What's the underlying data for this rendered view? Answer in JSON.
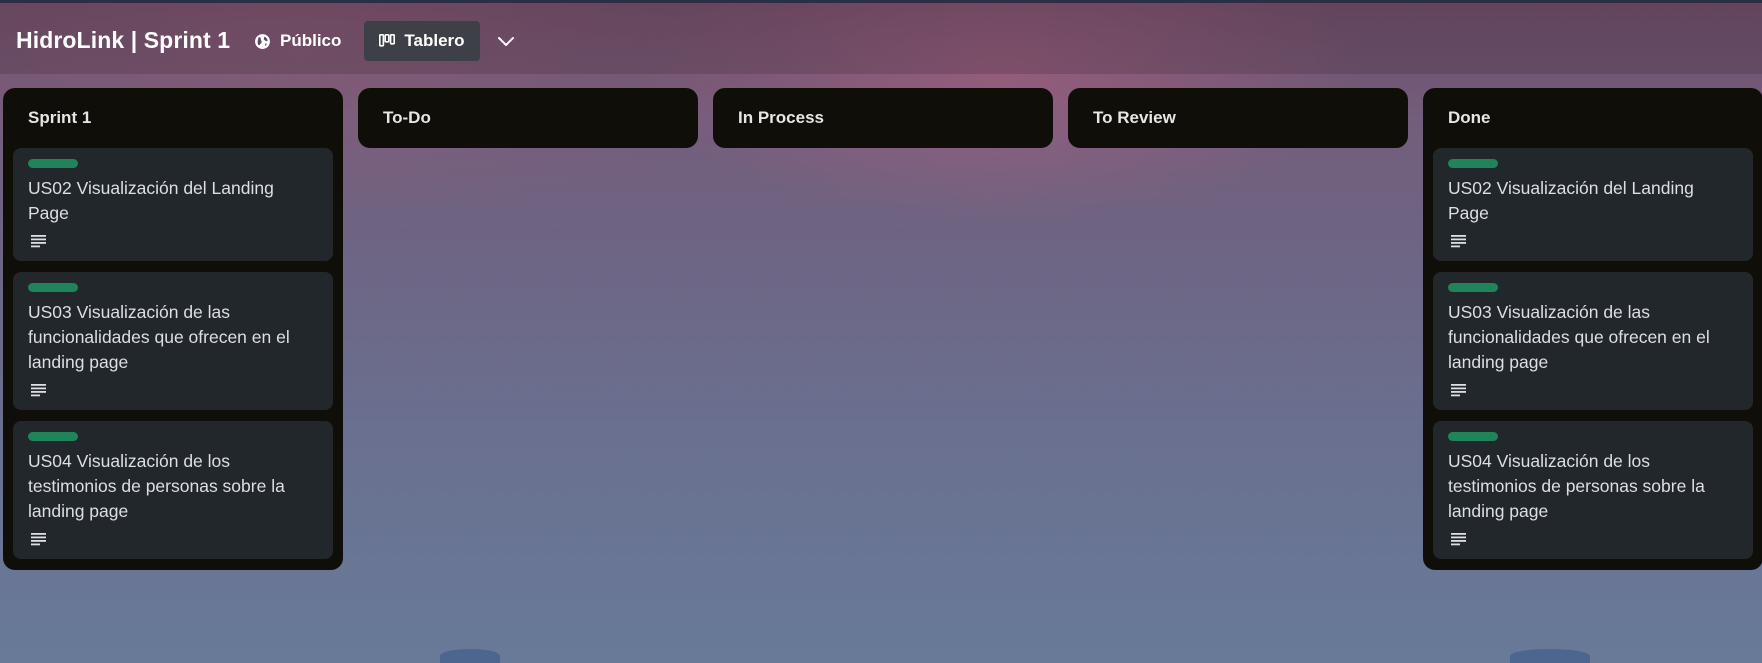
{
  "header": {
    "title": "HidroLink | Sprint 1",
    "visibility_label": "Público",
    "view_label": "Tablero",
    "icons": {
      "visibility": "globe-icon",
      "view": "board-icon",
      "views_dropdown": "chevron-down-icon"
    }
  },
  "colors": {
    "label_green": "#1f845a",
    "list_bg": "#0f0e08",
    "card_bg": "#22272b"
  },
  "lists": [
    {
      "title": "Sprint 1",
      "cards": [
        {
          "title": "US02 Visualización del Landing Page"
        },
        {
          "title": "US03 Visualización de las funcionalidades que ofrecen en el landing page"
        },
        {
          "title": "US04 Visualización de los testimonios de personas sobre la landing page"
        }
      ]
    },
    {
      "title": "To-Do",
      "cards": []
    },
    {
      "title": "In Process",
      "cards": []
    },
    {
      "title": "To Review",
      "cards": []
    },
    {
      "title": "Done",
      "cards": [
        {
          "title": "US02 Visualización del Landing Page"
        },
        {
          "title": "US03 Visualización de las funcionalidades que ofrecen en el landing page"
        },
        {
          "title": "US04 Visualización de los testimonios de personas sobre la landing page"
        }
      ]
    }
  ]
}
